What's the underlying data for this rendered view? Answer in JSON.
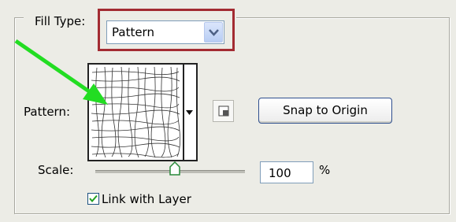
{
  "fill": {
    "label": "Fill Type:",
    "select_value": "Pattern"
  },
  "pattern": {
    "label": "Pattern:",
    "snap_button": "Snap to Origin"
  },
  "scale": {
    "label": "Scale:",
    "value": "100",
    "unit": "%",
    "slider_fraction": 0.53
  },
  "link": {
    "label": "Link with Layer",
    "checked": true
  },
  "colors": {
    "callout": "#a32b32",
    "arrow": "#22dd22"
  },
  "icons": {
    "dropdown": "chevron-down-icon",
    "snap": "new-preset-icon",
    "check": "check-icon",
    "slider": "slider-thumb-icon"
  }
}
